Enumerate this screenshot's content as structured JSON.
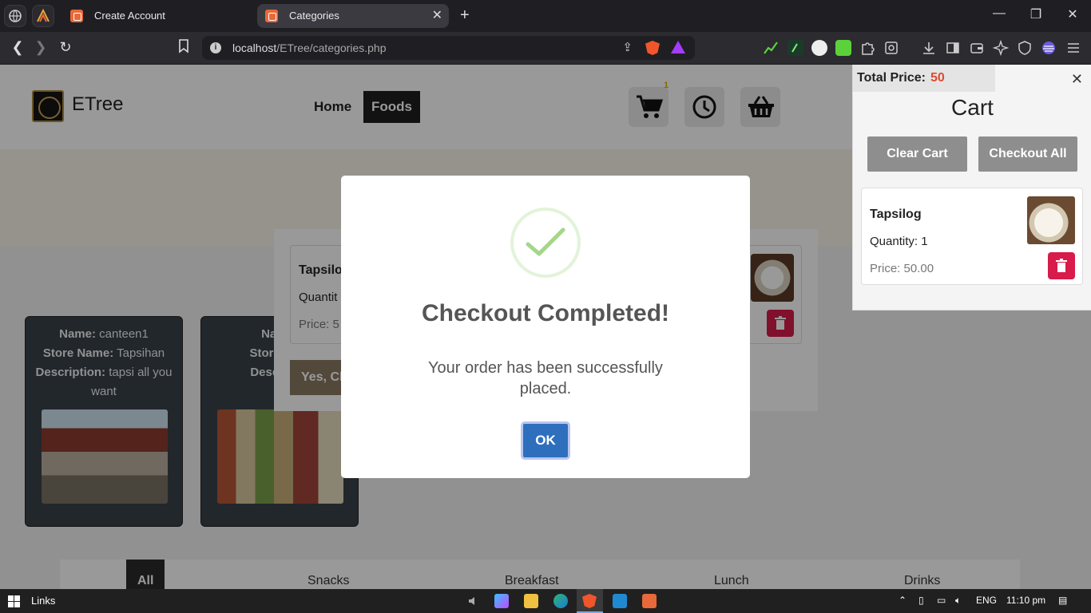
{
  "browser": {
    "tabs": [
      {
        "title": "Create Account",
        "active": false
      },
      {
        "title": "Categories",
        "active": true
      }
    ],
    "address": {
      "host": "localhost",
      "path": "/ETree/categories.php"
    }
  },
  "site": {
    "brand": "ETree",
    "nav": {
      "home": "Home",
      "foods": "Foods"
    },
    "cart_badge": "1"
  },
  "stores": [
    {
      "name_label": "Name:",
      "name": "canteen1",
      "store_label": "Store Name:",
      "store": "Tapsihan",
      "desc_label": "Description:",
      "desc": "tapsi all you want"
    },
    {
      "name_label": "Name:",
      "store_label": "Store Nam",
      "desc_label": "Descriptio"
    }
  ],
  "confirm": {
    "item_name": "Tapsilog",
    "qty_label": "Quantit",
    "price_label": "Price: 5",
    "yes_label": "Yes, Ch"
  },
  "categories": [
    "All",
    "Snacks",
    "Breakfast",
    "Lunch",
    "Drinks"
  ],
  "cart": {
    "total_label": "Total Price:",
    "total_value": "50",
    "title": "Cart",
    "clear": "Clear Cart",
    "checkout_all": "Checkout All",
    "item": {
      "name": "Tapsilog",
      "quantity": "Quantity: 1",
      "price": "Price: 50.00"
    }
  },
  "modal": {
    "title": "Checkout Completed!",
    "message": "Your order has been successfully placed.",
    "ok": "OK"
  },
  "taskbar": {
    "links": "Links",
    "lang": "ENG",
    "time": "11:10 pm"
  },
  "colors": {
    "accent_red": "#d81b4a",
    "ok_blue": "#2e6fbd",
    "price_orange": "#e04a2f"
  }
}
